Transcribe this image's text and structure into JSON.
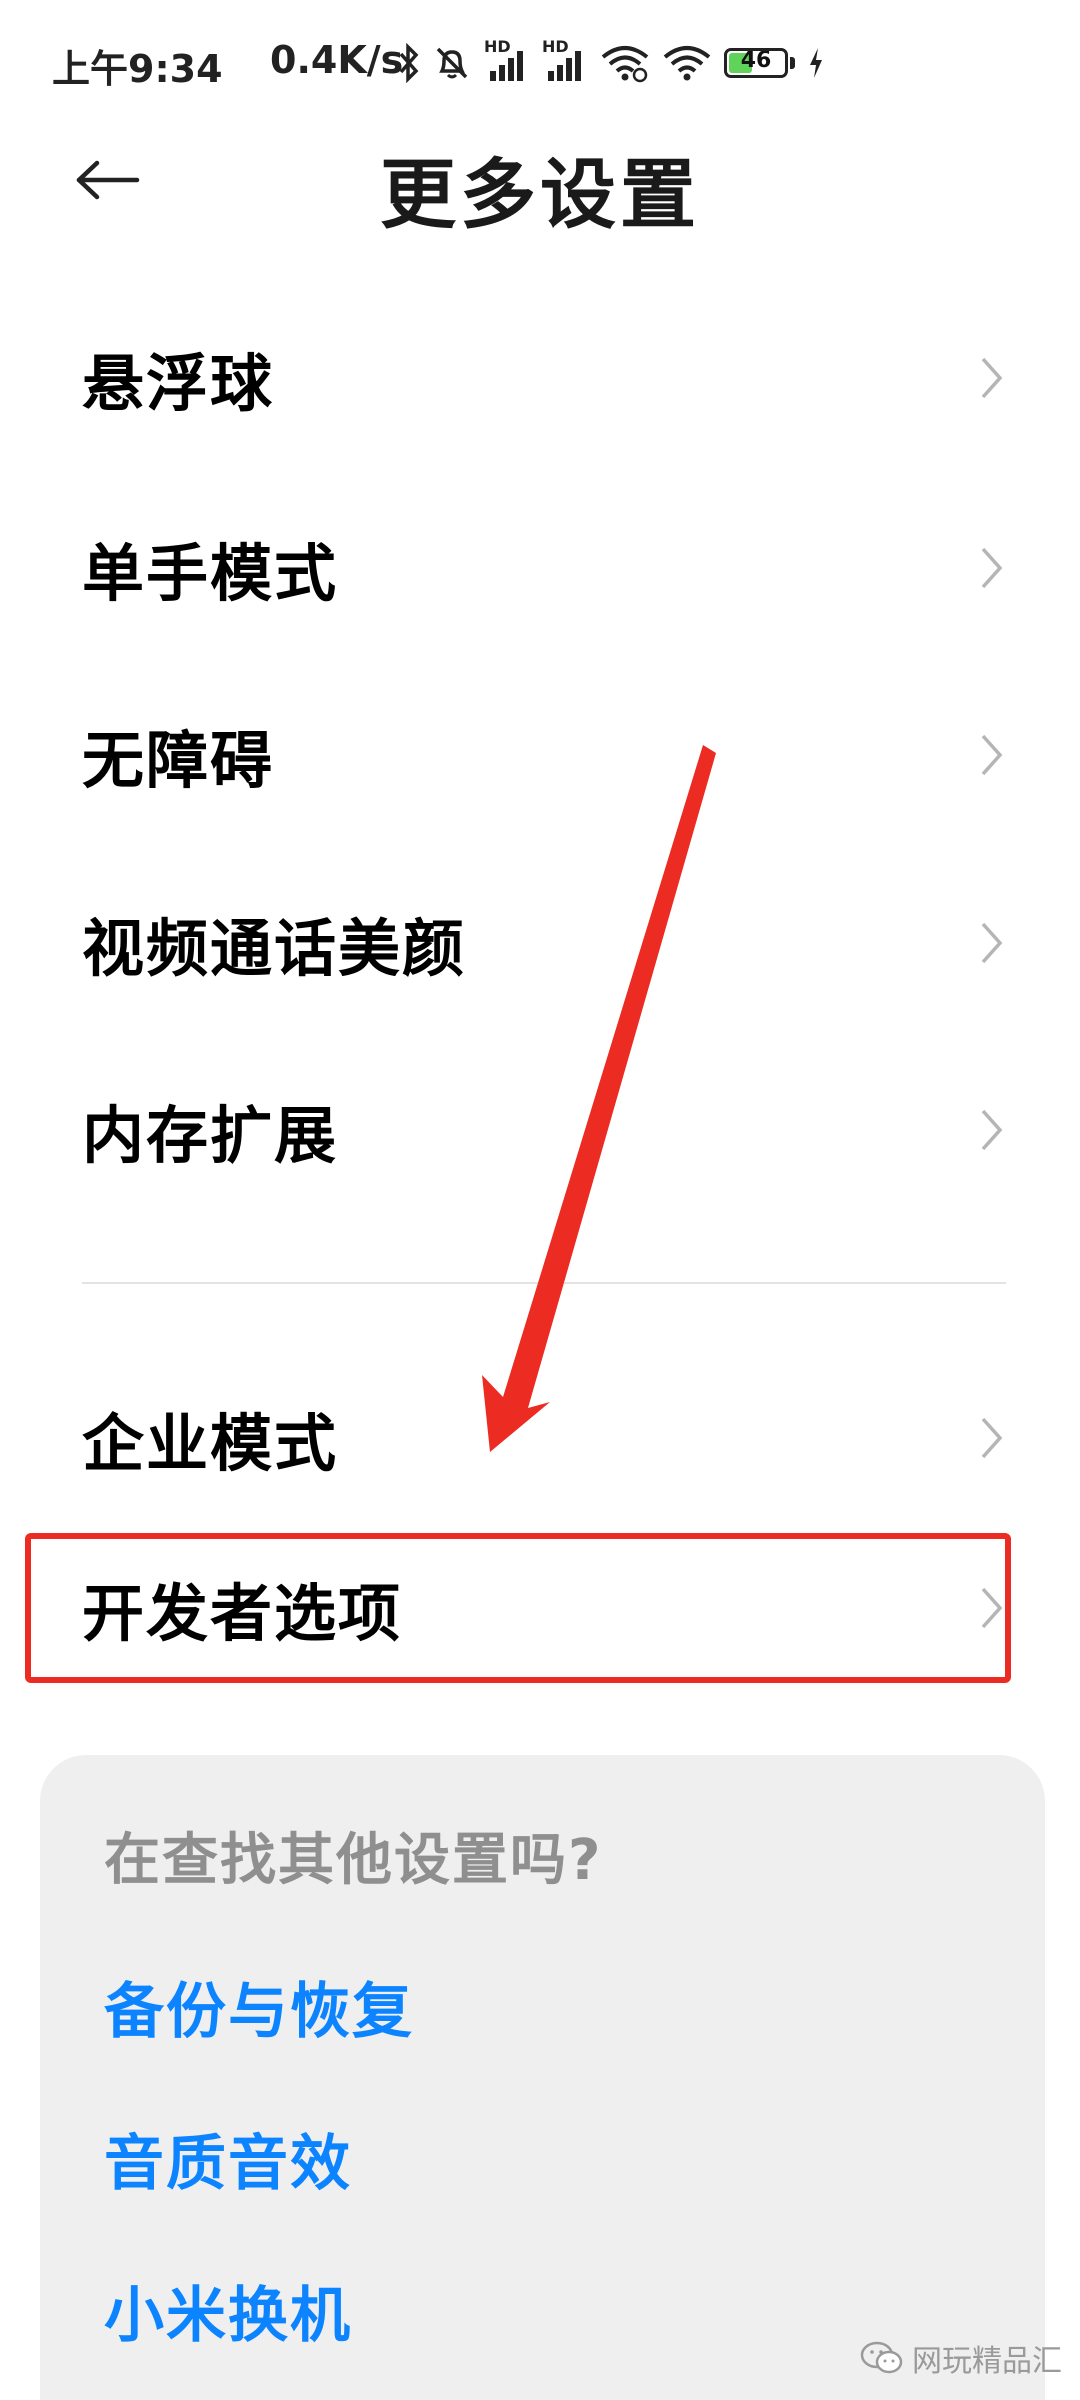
{
  "status_bar": {
    "time": "上午9:34",
    "net_speed": "0.4K/s",
    "signal_badge_1": "HD",
    "signal_badge_2": "HD",
    "battery_level": "46",
    "battery_fraction": 0.46,
    "icons": [
      "bluetooth-icon",
      "mute-bell-icon",
      "signal-hd-icon",
      "signal-hd-icon",
      "wifi-link-icon",
      "wifi-icon",
      "battery-icon",
      "charging-icon"
    ]
  },
  "header": {
    "title": "更多设置",
    "back_icon": "arrow-left-icon"
  },
  "menu": {
    "items": [
      {
        "label": "悬浮球"
      },
      {
        "label": "单手模式"
      },
      {
        "label": "无障碍"
      },
      {
        "label": "视频通话美颜"
      },
      {
        "label": "内存扩展"
      },
      {
        "label": "企业模式"
      },
      {
        "label": "开发者选项",
        "highlighted": true
      }
    ],
    "chevron_icon": "chevron-right-icon"
  },
  "annotation": {
    "arrow_color": "#ec2b22",
    "box_color": "#ec2b22"
  },
  "suggestions": {
    "title": "在查找其他设置吗?",
    "links": [
      {
        "label": "备份与恢复"
      },
      {
        "label": "音质音效"
      },
      {
        "label": "小米换机"
      }
    ],
    "link_color": "#0d84ff"
  },
  "watermark": {
    "text": "网玩精品汇",
    "icon": "wechat-icon"
  }
}
